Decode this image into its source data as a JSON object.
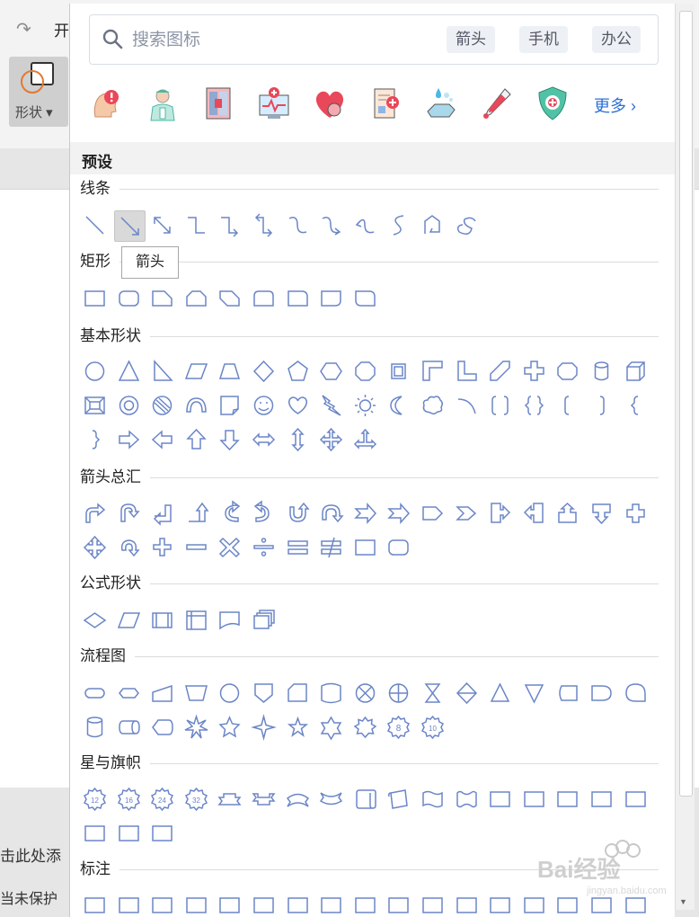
{
  "background": {
    "redo_icon": "redo-icon",
    "tab_label": "开",
    "shape_button_label": "形状 ▾",
    "click_text": "击此处添",
    "protect_text": "当未保护"
  },
  "search": {
    "placeholder": "搜索图标",
    "tags": [
      "箭头",
      "手机",
      "办公"
    ]
  },
  "icon_library": {
    "icons": [
      "head-alert-icon",
      "doctor-icon",
      "fridge-icon",
      "monitor-health-icon",
      "heart-icon",
      "report-icon",
      "hand-wash-icon",
      "thermometer-icon",
      "shield-icon"
    ],
    "more_label": "更多"
  },
  "preset_label": "预设",
  "tooltip": "箭头",
  "colors": {
    "shape": "#6b86c7",
    "accent": "#2d6fd6"
  },
  "sections": [
    {
      "title": "线条",
      "rows": [
        12
      ]
    },
    {
      "title": "矩形",
      "rows": [
        9
      ]
    },
    {
      "title": "基本形状",
      "rows": [
        17,
        17,
        9
      ]
    },
    {
      "title": "箭头总汇",
      "rows": [
        17,
        10
      ]
    },
    {
      "title": "公式形状",
      "rows": [
        6
      ]
    },
    {
      "title": "流程图",
      "rows": [
        17,
        11
      ]
    },
    {
      "title": "星与旗帜",
      "rows": [
        17,
        3
      ]
    },
    {
      "title": "标注",
      "rows": [
        17
      ]
    }
  ],
  "watermark": "Bai 经验"
}
